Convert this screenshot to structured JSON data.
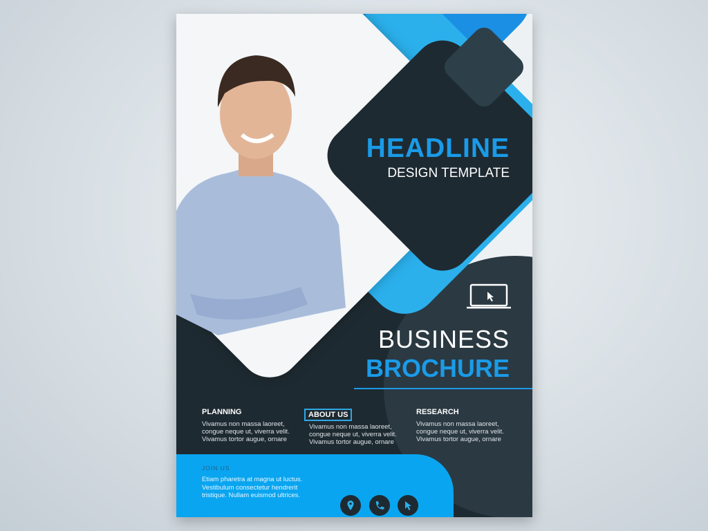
{
  "headline": "HEADLINE",
  "subheadline": "DESIGN TEMPLATE",
  "title_line1": "BUSINESS",
  "title_line2": "BROCHURE",
  "columns": [
    {
      "heading": "PLANNING",
      "body": [
        "Vivamus non massa laoreet,",
        "congue neque ut, viverra velit.",
        "Vivamus tortor augue, ornare"
      ]
    },
    {
      "heading": "ABOUT US",
      "body": [
        "Vivamus non massa laoreet,",
        "congue neque ut, viverra velit.",
        "Vivamus tortor augue, ornare"
      ]
    },
    {
      "heading": "RESEARCH",
      "body": [
        "Vivamus non massa laoreet,",
        "congue neque ut, viverra velit.",
        "Vivamus tortor augue, ornare"
      ]
    }
  ],
  "join": {
    "label": "JOIN US",
    "body": [
      "Etiam pharetra at magna ut luctus.",
      "Vestibulum consectetur hendrerit",
      "tristique. Nullam euismod ultrices."
    ]
  },
  "icons": [
    "location-pin-icon",
    "phone-icon",
    "cursor-icon",
    "laptop-icon"
  ],
  "colors": {
    "dark": "#1e2a31",
    "blue": "#13a0ef",
    "light_blue": "#2bb0ec"
  }
}
